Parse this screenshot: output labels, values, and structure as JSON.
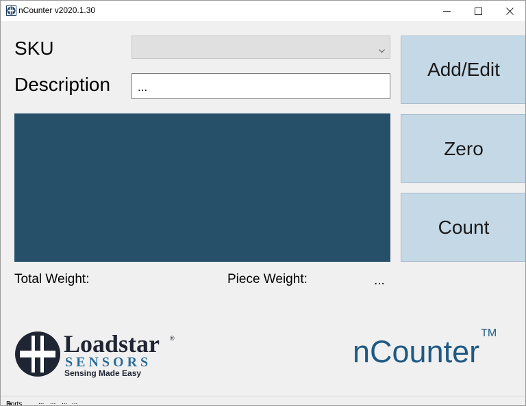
{
  "window": {
    "title": "nCounter v2020.1.30",
    "controls": [
      "minimize-icon",
      "maximize-icon",
      "close-icon"
    ]
  },
  "form": {
    "sku_label": "SKU",
    "sku_value": "",
    "description_label": "Description",
    "description_value": "..."
  },
  "buttons": {
    "add_edit": "Add/Edit",
    "zero": "Zero",
    "count": "Count"
  },
  "readouts": {
    "total_weight_label": "Total Weight:",
    "total_weight_value": "",
    "piece_weight_label": "Piece Weight:",
    "piece_weight_value": "..."
  },
  "branding": {
    "logo_name": "Loadstar",
    "logo_registered": "®",
    "logo_sensors": "SENSORS",
    "logo_tagline": "Sensing Made Easy",
    "product_name": "nCounter",
    "product_tm": "TM"
  },
  "statusbar": {
    "ports_label": "Ports",
    "ports_dropdown_icon": "caret-down-icon",
    "items": [
      "...",
      "...",
      "...",
      "..."
    ]
  },
  "colors": {
    "display_panel": "#264f69",
    "button_bg": "#c4d8e6",
    "brand_blue": "#1f5a84"
  }
}
